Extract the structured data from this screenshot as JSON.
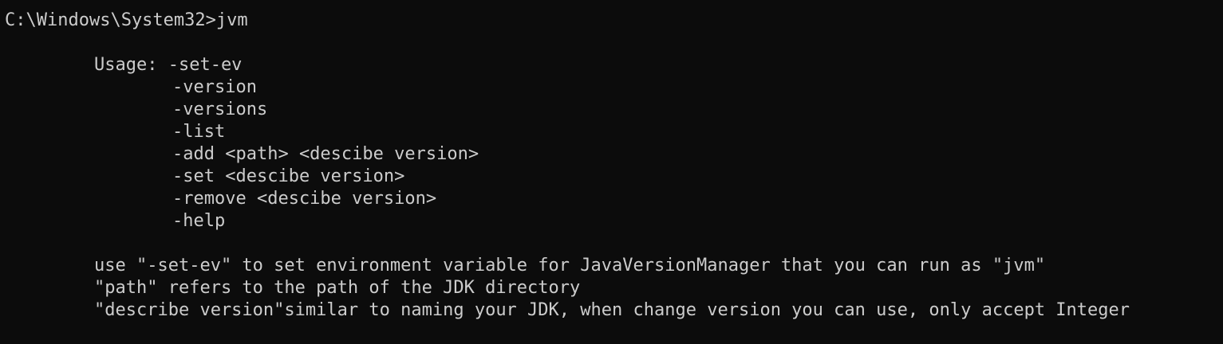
{
  "terminal": {
    "prompt": "C:\\Windows\\System32>jvm",
    "usage_label": "Usage: -set-ev",
    "options": [
      "-version",
      "-versions",
      "-list",
      "-add <path> <descibe version>",
      "-set <descibe version>",
      "-remove <descibe version>",
      "-help"
    ],
    "notes": [
      "use \"-set-ev\" to set environment variable for JavaVersionManager that you can run as \"jvm\"",
      "\"path\" refers to the path of the JDK directory",
      "\"describe version\"similar to naming your JDK, when change version you can use, only accept Integer"
    ]
  }
}
